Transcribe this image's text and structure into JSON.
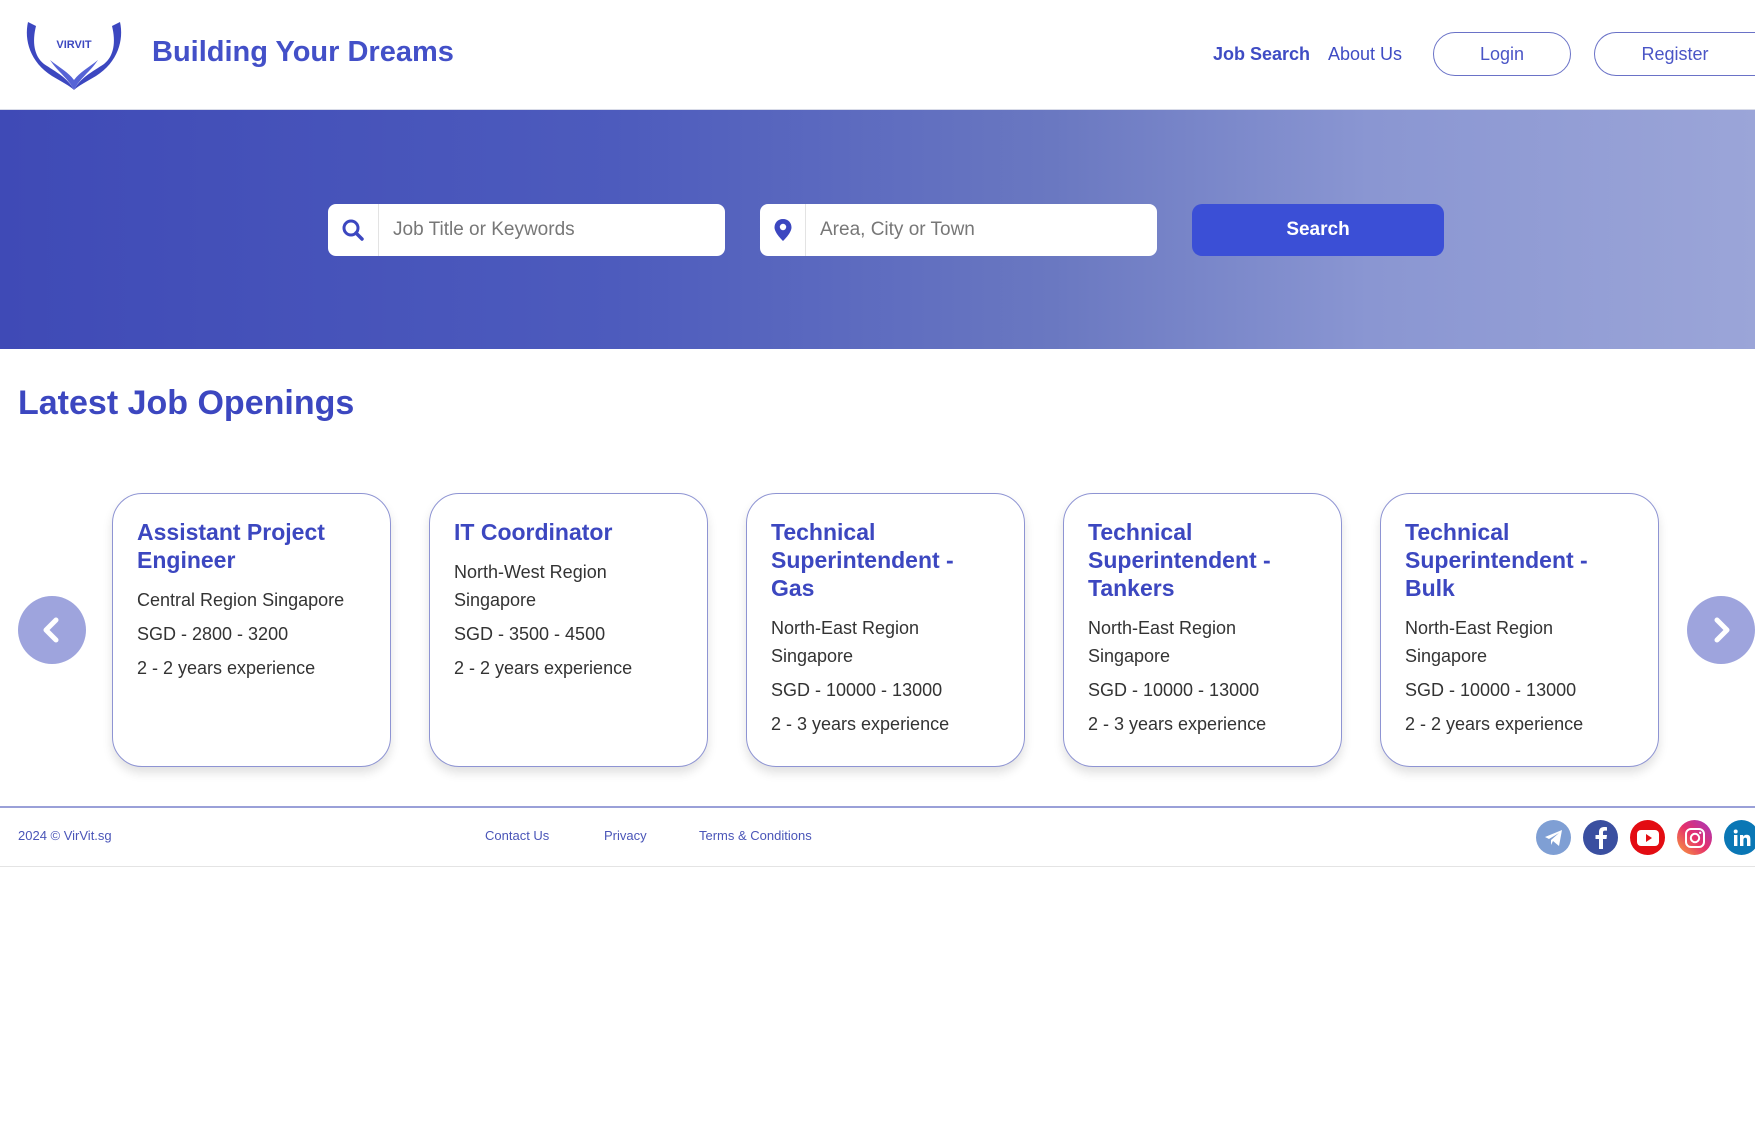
{
  "header": {
    "brand": "Building Your Dreams",
    "logo_text": "VIRVIT",
    "nav": {
      "job_search": "Job Search",
      "about_us": "About Us"
    },
    "login_label": "Login",
    "register_label": "Register"
  },
  "hero": {
    "keywords_placeholder": "Job Title or Keywords",
    "location_placeholder": "Area, City or Town",
    "search_label": "Search"
  },
  "section": {
    "title": "Latest Job Openings"
  },
  "jobs": [
    {
      "title": "Assistant Project Engineer",
      "location": "Central Region Singapore",
      "salary": "SGD - 2800 - 3200",
      "experience": "2 - 2 years experience"
    },
    {
      "title": "IT Coordinator",
      "location": "North-West Region Singapore",
      "salary": "SGD - 3500 - 4500",
      "experience": "2 - 2 years experience"
    },
    {
      "title": "Technical Superintendent - Gas",
      "location": "North-East Region Singapore",
      "salary": "SGD - 10000 - 13000",
      "experience": "2 - 3 years experience"
    },
    {
      "title": "Technical Superintendent - Tankers",
      "location": "North-East Region Singapore",
      "salary": "SGD - 10000 - 13000",
      "experience": "2 - 3 years experience"
    },
    {
      "title": "Technical Superintendent - Bulk",
      "location": "North-East Region Singapore",
      "salary": "SGD - 10000 - 13000",
      "experience": "2 - 2 years experience"
    }
  ],
  "footer": {
    "copyright": "2024 © VirVit.sg",
    "contact": "Contact Us",
    "privacy": "Privacy",
    "terms": "Terms & Conditions",
    "social": [
      "telegram-icon",
      "facebook-icon",
      "youtube-icon",
      "instagram-icon",
      "linkedin-icon"
    ]
  },
  "colors": {
    "brand": "#4350c8",
    "search_button": "#3b4fd6",
    "arrow": "#9ea4dd"
  }
}
